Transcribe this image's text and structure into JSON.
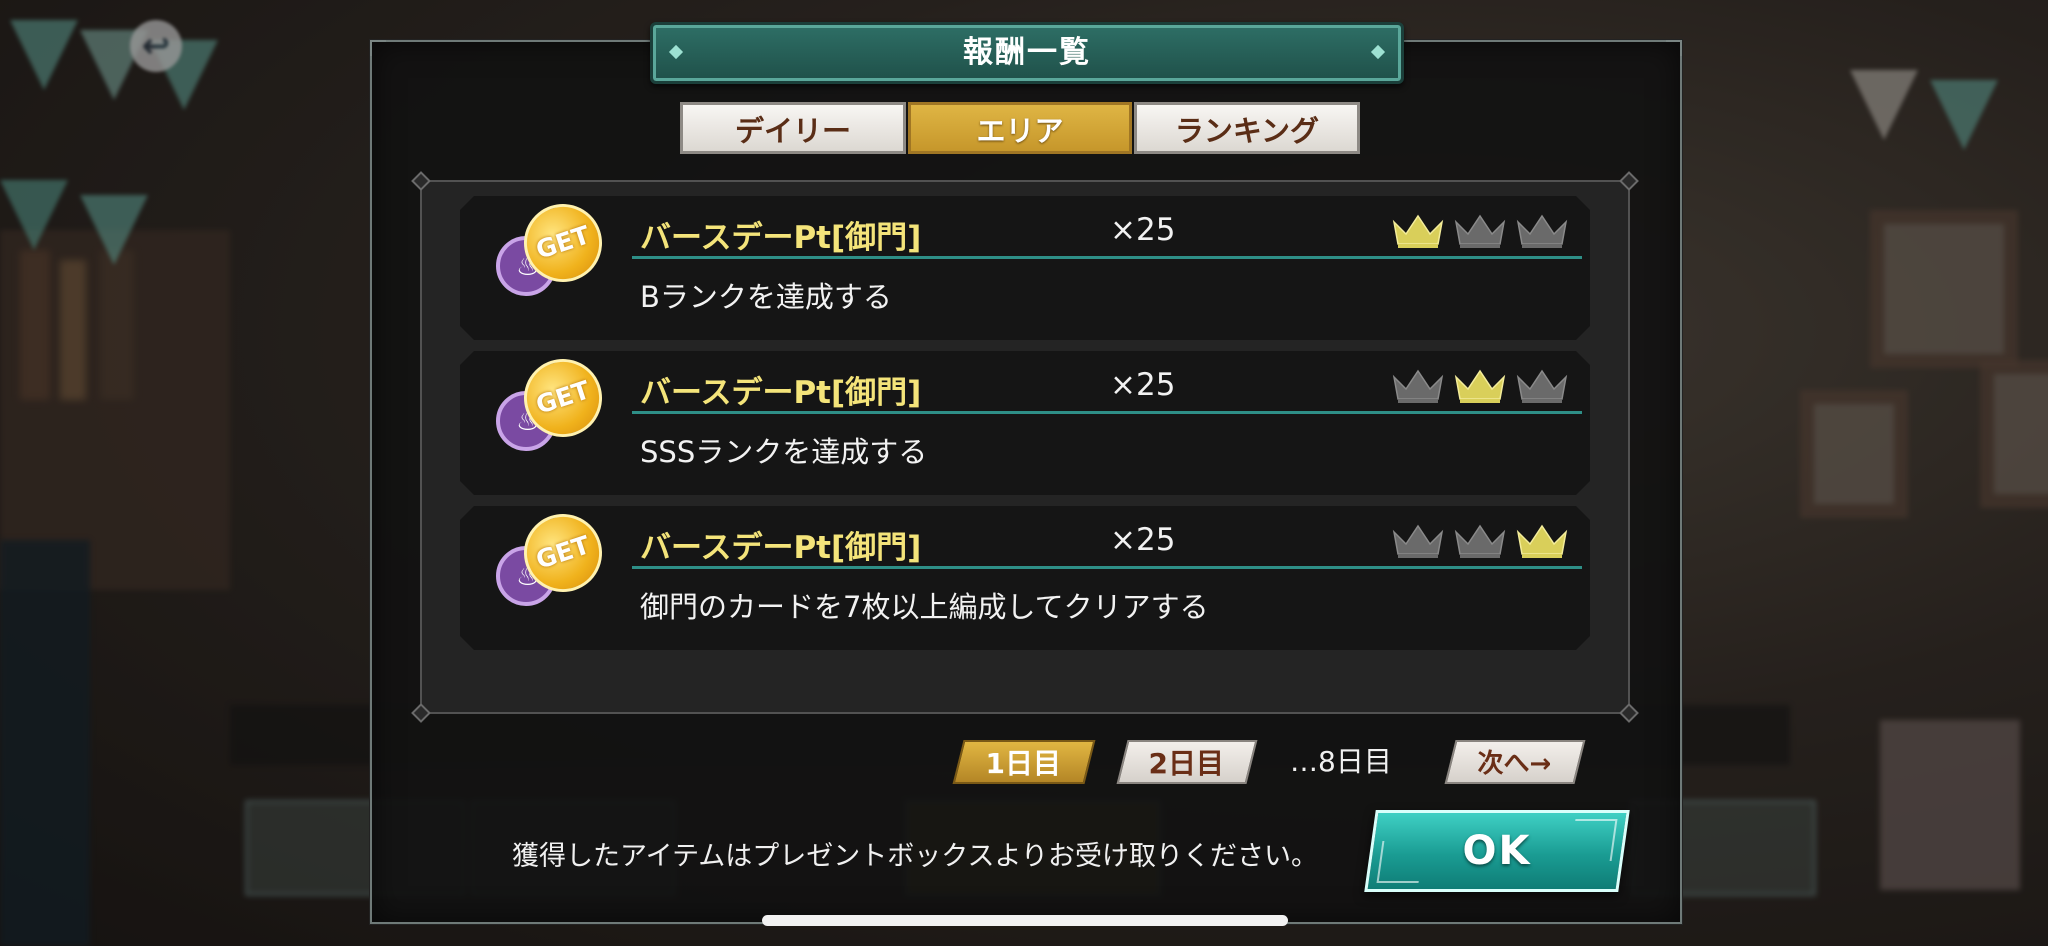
{
  "modal": {
    "title": "報酬一覧",
    "tabs": [
      {
        "label": "デイリー",
        "active": false
      },
      {
        "label": "エリア",
        "active": true
      },
      {
        "label": "ランキング",
        "active": false
      }
    ],
    "rewards": [
      {
        "badge": "GET",
        "item": "バースデーPt[御門]",
        "qty": "×25",
        "condition": "Bランクを達成する",
        "crowns_lit": [
          true,
          false,
          false
        ]
      },
      {
        "badge": "GET",
        "item": "バースデーPt[御門]",
        "qty": "×25",
        "condition": "SSSランクを達成する",
        "crowns_lit": [
          false,
          true,
          false
        ]
      },
      {
        "badge": "GET",
        "item": "バースデーPt[御門]",
        "qty": "×25",
        "condition": "御門のカードを7枚以上編成してクリアする",
        "crowns_lit": [
          false,
          false,
          true
        ]
      }
    ],
    "pager": {
      "day1": "1日目",
      "day2": "2日目",
      "ellipsis": "…8日目",
      "next": "次へ→"
    },
    "footer_note": "獲得したアイテムはプレゼントボックスよりお受け取りください。",
    "ok_label": "OK"
  },
  "colors": {
    "crown_lit": "#d9cf5a",
    "crown_dim": "#6a6a6a",
    "accent_teal": "#2e8f87",
    "tab_active": "#d1a636"
  }
}
